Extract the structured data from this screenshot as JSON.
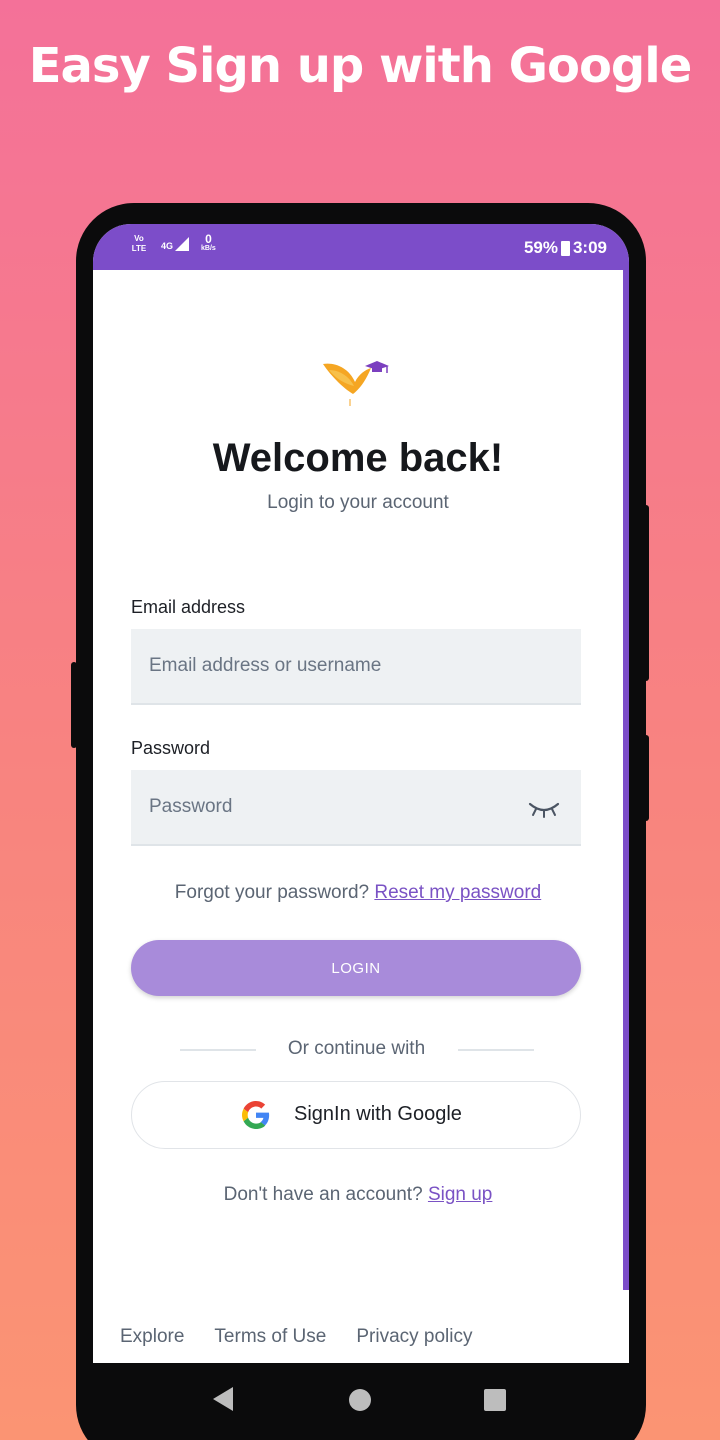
{
  "promo": {
    "title": "Easy Sign up with Google"
  },
  "status_bar": {
    "volte": "Vo LTE",
    "network": "4G",
    "speed_value": "0",
    "speed_unit": "kB/s",
    "battery": "59%",
    "time": "3:09"
  },
  "header": {
    "title": "Welcome back!",
    "subtitle": "Login to your account"
  },
  "form": {
    "email_label": "Email address",
    "email_placeholder": "Email address or username",
    "email_value": "",
    "password_label": "Password",
    "password_placeholder": "Password",
    "password_value": "",
    "forgot_text": "Forgot your password?",
    "reset_link": "Reset my password",
    "login_label": "LOGIN"
  },
  "alt_login": {
    "divider_text": "Or continue with",
    "google_label": "SignIn with Google"
  },
  "signup": {
    "prompt": "Don't have an account?",
    "link": "Sign up"
  },
  "footer": {
    "links": [
      "Explore",
      "Terms of Use",
      "Privacy policy"
    ]
  },
  "colors": {
    "accent": "#7c4dc9",
    "login_button": "#a88bda",
    "link": "#7a52c4"
  },
  "icons": [
    "volte-icon",
    "signal-icon",
    "battery-icon",
    "bird-logo-icon",
    "eye-closed-icon",
    "google-g-icon",
    "nav-back-icon",
    "nav-home-icon",
    "nav-recent-icon"
  ]
}
